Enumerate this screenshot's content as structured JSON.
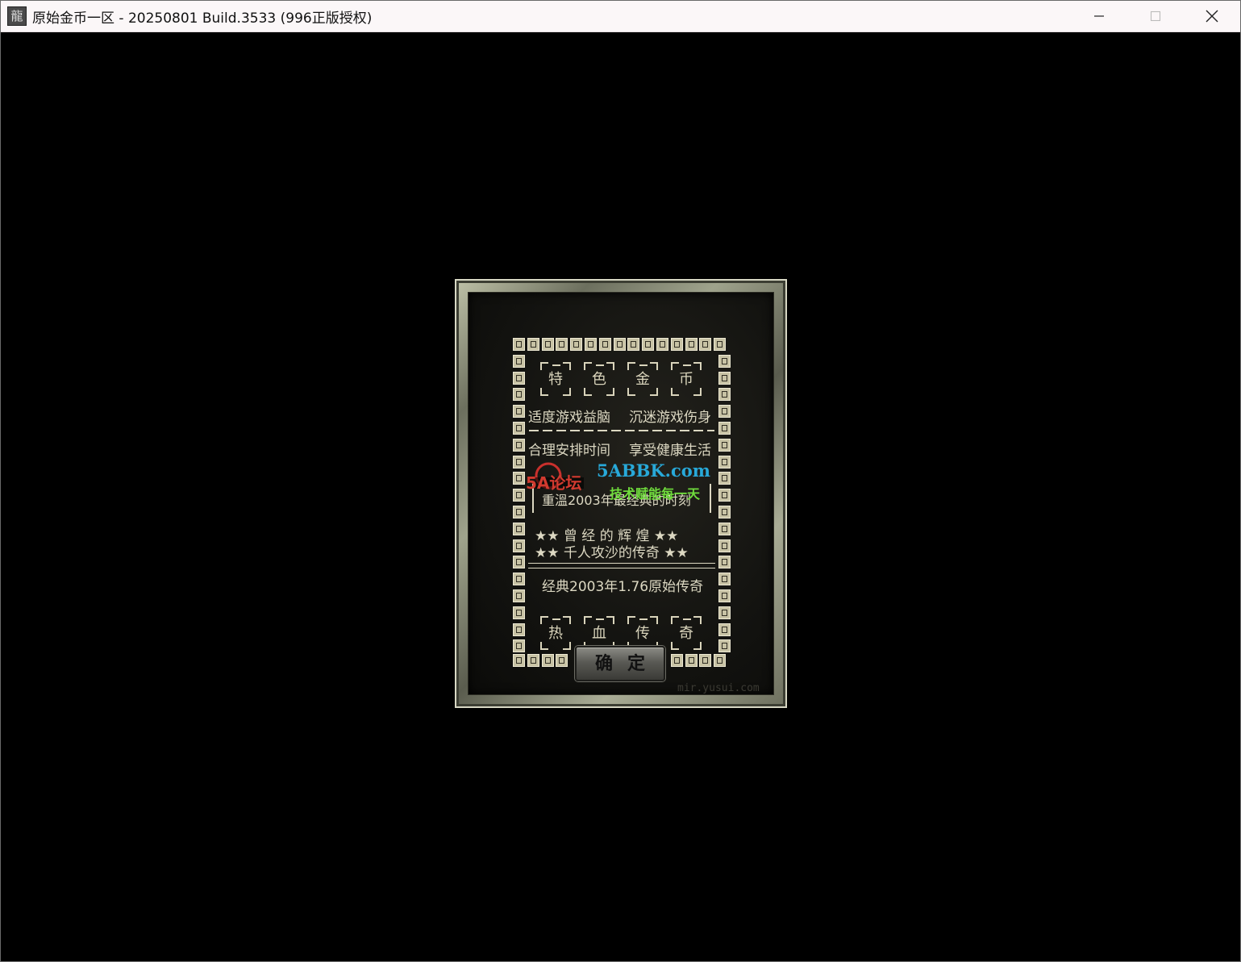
{
  "window": {
    "title": "原始金币一区 - 20250801 Build.3533 (996正版授权)",
    "icon_glyph": "龍"
  },
  "dialog": {
    "top_seals": [
      "特",
      "色",
      "金",
      "币"
    ],
    "line1_left": "适度游戏益脑",
    "line1_right": "沉迷游戏伤身",
    "line2_left": "合理安排时间",
    "line2_right": "享受健康生活",
    "boxed_line": "重溫2003年最经典的时刻",
    "stars_line1": "★★ 曾 经 的 辉 煌 ★★",
    "stars_line2": "★★ 千人攻沙的传奇 ★★",
    "classic_line": "经典2003年1.76原始传奇",
    "bottom_seals": [
      "热",
      "血",
      "传",
      "奇"
    ],
    "confirm_label": "确定",
    "corner_watermark": "mir.yusui.com"
  },
  "watermark": {
    "logo_text": "5A论坛",
    "site": "5ABBK.com",
    "slogan": "技术赋能每一天"
  }
}
